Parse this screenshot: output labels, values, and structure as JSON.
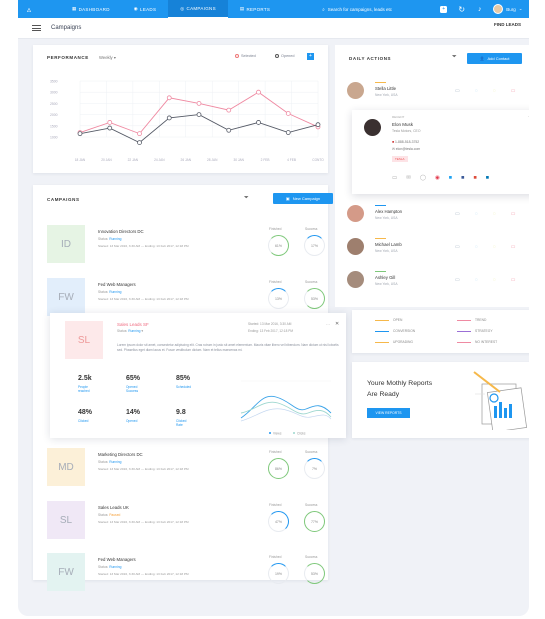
{
  "topbar": {
    "nav": [
      {
        "icon": "grid-icon",
        "label": "DASHBOARD"
      },
      {
        "icon": "pin-icon",
        "label": "LEADS"
      },
      {
        "icon": "target-icon",
        "label": "CAMPAIGNS"
      },
      {
        "icon": "report-icon",
        "label": "REPORTS"
      }
    ],
    "search_placeholder": "Search for campaigns, leads etc",
    "user_name": "Burg"
  },
  "subheader": {
    "title": "Campaigns",
    "find_leads": "FIND LEADS"
  },
  "performance": {
    "title": "PERFORMANCE",
    "period": "Weekly",
    "legend_selected": "Selected",
    "legend_opened": "Opened"
  },
  "chart_data": {
    "type": "line",
    "categories": [
      "18 JAN",
      "20 JAN",
      "22 JAN",
      "24 JAN",
      "26 JAN",
      "28 JAN",
      "30 JAN",
      "2 FEB",
      "4 FEB",
      "CONTO"
    ],
    "yticks": [
      "3500",
      "3000",
      "2500",
      "2000",
      "1500",
      "1000"
    ],
    "ylim": [
      1000,
      3500
    ],
    "series": [
      {
        "name": "Selected",
        "color": "#ef8aa2",
        "values": [
          1200,
          1650,
          1150,
          2750,
          2500,
          2200,
          3000,
          2050,
          1450
        ]
      },
      {
        "name": "Opened",
        "color": "#555a66",
        "values": [
          1150,
          1400,
          750,
          1850,
          2000,
          1300,
          1650,
          1200,
          1550
        ]
      }
    ]
  },
  "campaigns": {
    "title": "CAMPAIGNS",
    "new_button": "New Campaign",
    "finished_label": "Finished",
    "success_label": "Success",
    "rows": [
      {
        "initials": "ID",
        "tile": "#e6f4e4",
        "title": "Innovation Directors DC",
        "status_label": "Status:",
        "status": "Running",
        "date": "Started: 13 Mar 2016, 3:30 AM  —  Ending: 13 Feb 2017, 12:18 PM",
        "finished": "61%",
        "success": "17%"
      },
      {
        "initials": "FW",
        "tile": "#e2eefb",
        "title": "Fed Web Managers",
        "status_label": "Status:",
        "status": "Running",
        "date": "Started: 13 Mar 2016, 3:30 AM  —  Ending: 13 Feb 2017, 12:18 PM",
        "finished": "13%",
        "success": "53%"
      },
      {
        "initials": "MD",
        "tile": "#fcf0d8",
        "title": "Marketing Directors DC",
        "status_label": "Status:",
        "status": "Running",
        "date": "Started: 13 Mar 2016, 3:30 AM  —  Ending: 13 Feb 2017, 12:18 PM",
        "finished": "86%",
        "success": "7%"
      },
      {
        "initials": "SL",
        "tile": "#f0e8f6",
        "title": "Sales Leads UK",
        "status_label": "Status:",
        "status": "Paused",
        "date": "Started: 13 Mar 2016, 3:30 AM  —  Ending: 13 Feb 2017, 12:18 PM",
        "finished": "47%",
        "success": "77%"
      },
      {
        "initials": "FW",
        "tile": "#e3f3f1",
        "title": "Fed Web Managers",
        "status_label": "Status:",
        "status": "Running",
        "date": "Started: 13 Mar 2016, 3:30 AM  —  Ending: 13 Feb 2017, 12:18 PM",
        "finished": "19%",
        "success": "53%"
      }
    ]
  },
  "expanded": {
    "initials": "SL",
    "title": "Sales Leads SF",
    "status_label": "Status:",
    "status": "Running",
    "started": "Started: 13 Mar 2016, 3:30 AM",
    "ending": "Ending: 13 Feb 2017, 12:18 PM",
    "desc": "Lorem ipsum dolor sit amet, consectetur adipiscing elit. Cras rutrum in justo sit amet elementum. Mauris vitae libero vel bibendum. Nam dictum ut nisl lobortis sed. Phasellus eget diam lacus et. Fusce vestibulum dictum. Nam et tellus maecenas mi.",
    "stats": [
      {
        "value": "2.5k",
        "label": "People\nreached"
      },
      {
        "value": "65%",
        "label": "Opened\nSuccess"
      },
      {
        "value": "85%",
        "label": "Scheduled"
      },
      {
        "value": "48%",
        "label": "Clicked"
      },
      {
        "value": "14%",
        "label": "Opened"
      },
      {
        "value": "9.8",
        "label": "Clicked\nRate"
      }
    ],
    "mini_legend": [
      "Views",
      "Clicks"
    ]
  },
  "daily": {
    "title": "DAILY ACTIONS",
    "add_button": "Add Contact",
    "people": [
      {
        "name": "Stella Little",
        "loc": "New York, USA",
        "line": "#f6b84a",
        "av": "#c9a78f"
      },
      {
        "name": "Alex Hampton",
        "loc": "New York, USA",
        "line": "#1e96f0",
        "av": "#d49a88"
      },
      {
        "name": "Michael Lamb",
        "loc": "New York, USA",
        "line": "#f6b84a",
        "av": "#9e7f6e"
      },
      {
        "name": "Ashley Gill",
        "loc": "New York, USA",
        "line": "#7ec87a",
        "av": "#a58c7c"
      }
    ],
    "elon": {
      "tag": "RECENT",
      "name": "Elon Musk",
      "role": "Tesla Motors, CEO",
      "phone": "1-888-518-3752",
      "email": "elon@tesla.com",
      "badge": "TESLA",
      "loc": "New York, USA"
    }
  },
  "legend_card": {
    "items": [
      {
        "label": "OPEN",
        "color": "#f6b84a"
      },
      {
        "label": "TREND",
        "color": "#ef8aa2"
      },
      {
        "label": "CONVERSION",
        "color": "#1e96f0"
      },
      {
        "label": "STRATEGY",
        "color": "#9b6fd6"
      },
      {
        "label": "UPGRADING",
        "color": "#f6b84a"
      },
      {
        "label": "NO INTEREST",
        "color": "#ef8aa2"
      }
    ]
  },
  "reports": {
    "line1": "Youre Mothly Reports",
    "line2": "Are Ready",
    "button": "VIEW REPORTS"
  }
}
